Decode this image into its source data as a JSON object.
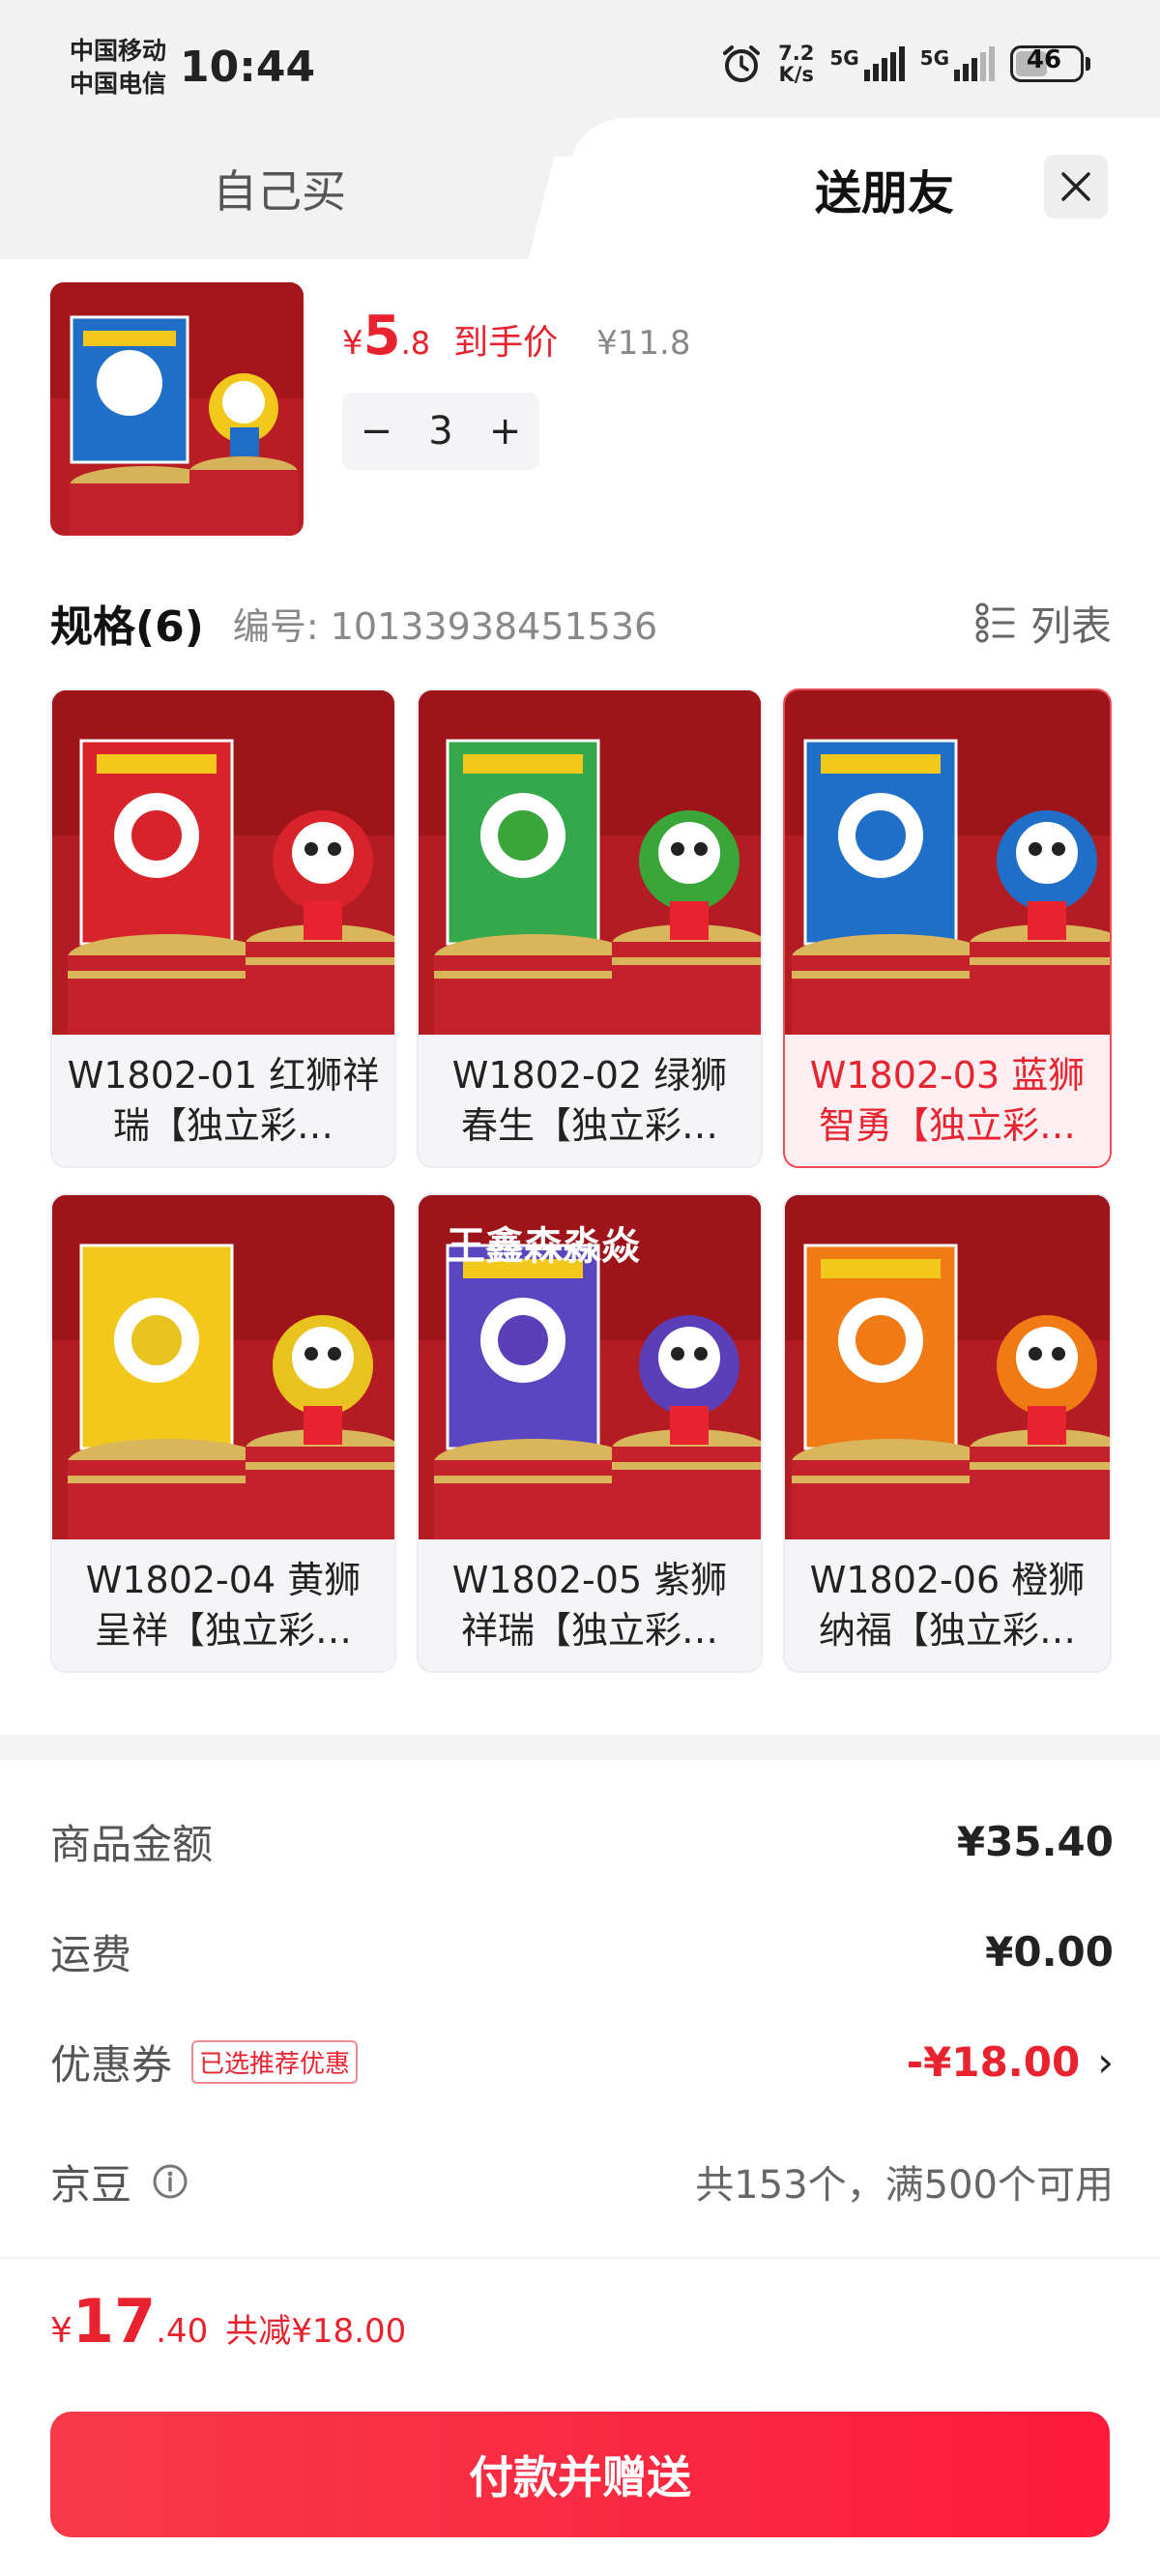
{
  "status_bar": {
    "carrier1": "中国移动",
    "carrier2": "中国电信",
    "time": "10:44",
    "net_speed_value": "7.2",
    "net_speed_unit": "K/s",
    "signal1": "5G",
    "signal2": "5G",
    "battery": "46"
  },
  "tabs": {
    "buy_self": "自己买",
    "gift": "送朋友"
  },
  "product": {
    "currency": "¥",
    "price_int": "5",
    "price_dec": ".8",
    "final_price_label": "到手价",
    "original_price": "¥11.8",
    "quantity": "3",
    "minus": "−",
    "plus": "+"
  },
  "spec": {
    "title": "规格(6)",
    "code": "编号: 10133938451536",
    "list_label": "列表"
  },
  "variants": [
    {
      "line1": "W1802-01 红狮祥",
      "line2": "瑞【独立彩…",
      "color": "#d8232a",
      "box": "#d8232a",
      "selected": false
    },
    {
      "line1": "W1802-02 绿狮",
      "line2": "春生【独立彩…",
      "color": "#3aa63a",
      "box": "#34a84a",
      "selected": false
    },
    {
      "line1": "W1802-03 蓝狮",
      "line2": "智勇【独立彩…",
      "color": "#1f6fc9",
      "box": "#1f6fc9",
      "selected": true
    },
    {
      "line1": "W1802-04 黄狮",
      "line2": "呈祥【独立彩…",
      "color": "#e8c21e",
      "box": "#f2c81c",
      "selected": false
    },
    {
      "line1": "W1802-05 紫狮",
      "line2": "祥瑞【独立彩…",
      "color": "#5b3fb8",
      "box": "#5a46c0",
      "selected": false
    },
    {
      "line1": "W1802-06 橙狮",
      "line2": "纳福【独立彩…",
      "color": "#f07a14",
      "box": "#f07a14",
      "selected": false
    }
  ],
  "watermark": "王鑫森淼焱",
  "fees": {
    "goods_label": "商品金额",
    "goods_value": "¥35.40",
    "shipping_label": "运费",
    "shipping_value": "¥0.00",
    "coupon_label": "优惠券",
    "coupon_tag": "已选推荐优惠",
    "coupon_value": "-¥18.00",
    "beans_label": "京豆",
    "beans_value": "共153个，满500个可用"
  },
  "total": {
    "currency": "¥",
    "int": "17",
    "dec": ".40",
    "saved": "共减¥18.00"
  },
  "pay_button": "付款并赠送",
  "colors": {
    "accent": "#e8232f",
    "bg_gray": "#f2f2f3"
  }
}
